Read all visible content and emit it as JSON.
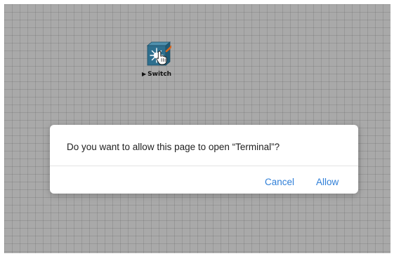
{
  "canvas": {
    "background_color": "#a9a9a9"
  },
  "device": {
    "label": "Switch",
    "icon": "switch-icon",
    "icon_color": "#2e6f8e"
  },
  "dialog": {
    "message": "Do you want to allow this page to open “Terminal”?",
    "cancel_label": "Cancel",
    "allow_label": "Allow",
    "button_color": "#2f7fd8"
  }
}
